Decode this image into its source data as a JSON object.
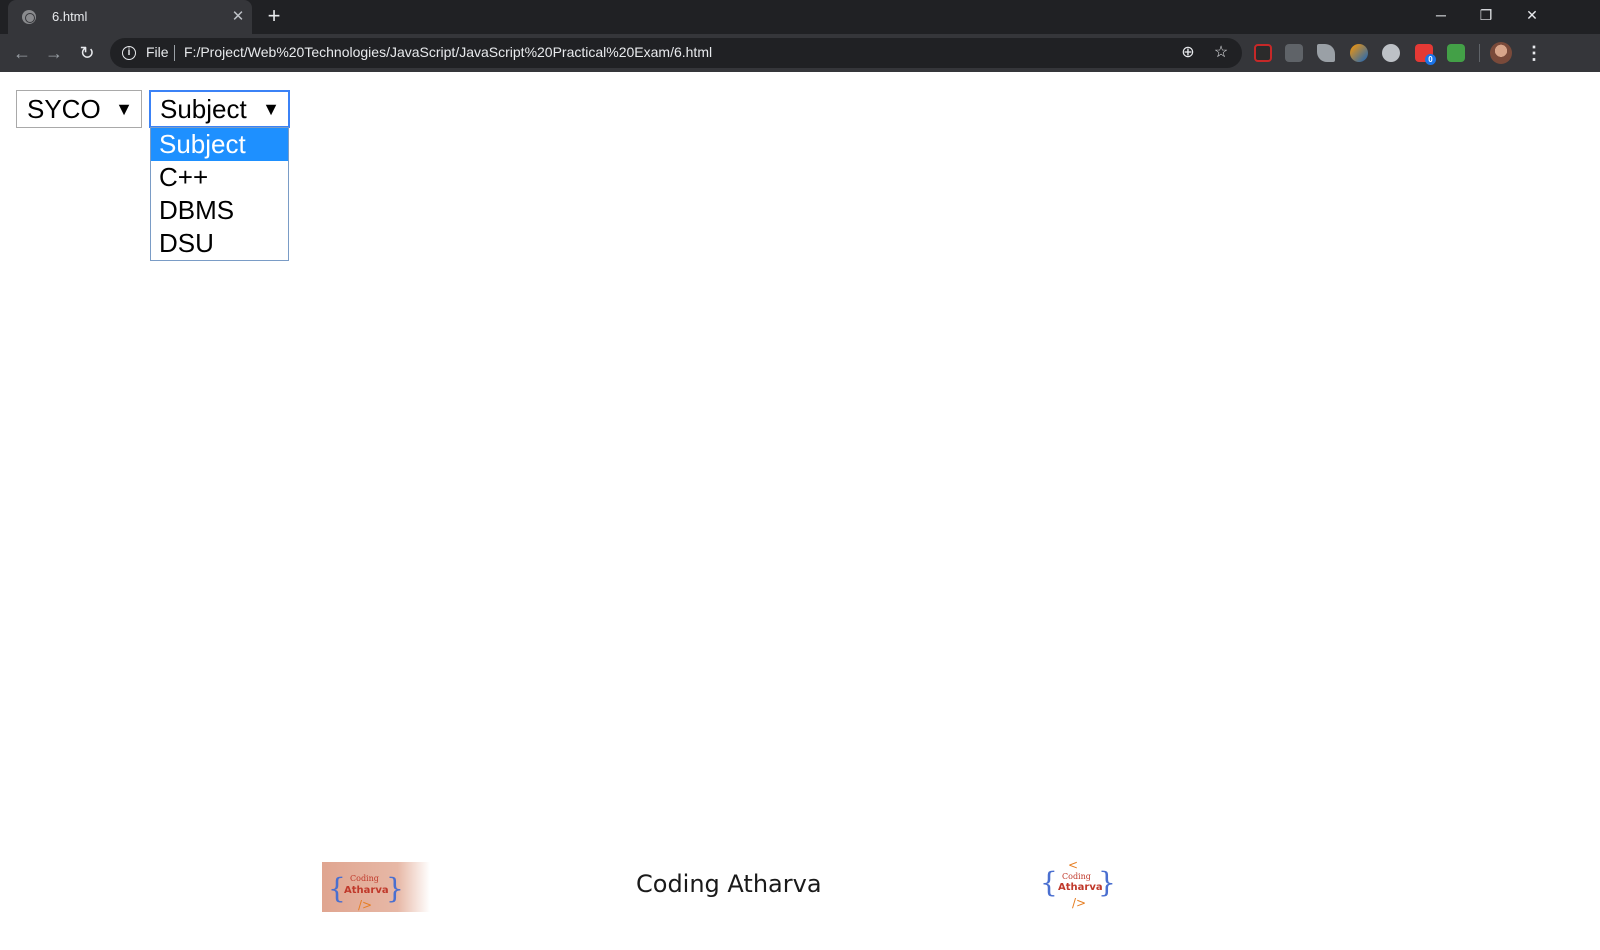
{
  "browser": {
    "tab_title": "6.html",
    "tab_close": "✕",
    "new_tab": "+",
    "window_controls": {
      "minimize": "─",
      "restore": "❐",
      "close": "✕"
    },
    "nav": {
      "back": "←",
      "forward": "→",
      "reload": "↻"
    },
    "omnibox": {
      "info_icon": "i",
      "scheme_label": "File",
      "url": "F:/Project/Web%20Technologies/JavaScript/JavaScript%20Practical%20Exam/6.html",
      "zoom_icon": "⊕",
      "star_icon": "☆"
    },
    "extension_badge": "0",
    "menu_icon": "⋮",
    "colors": {
      "tabstrip": "#202124",
      "toolbar": "#35363a",
      "omnibox": "#202124"
    }
  },
  "page": {
    "class_select": {
      "value": "SYCO",
      "arrow": "▼"
    },
    "subject_select": {
      "value": "Subject",
      "arrow": "▼",
      "expanded": true,
      "options": [
        "Subject",
        "C++",
        "DBMS",
        "DSU"
      ],
      "highlighted_index": 0
    },
    "colors": {
      "highlight": "#1e90ff",
      "focus_ring": "#3b82f6"
    }
  },
  "footer": {
    "title": "Coding Atharva",
    "logo": {
      "small_word": "Coding",
      "bold_word": "Atharva",
      "open_brace": "{",
      "close_brace": "}",
      "tag_top": "<",
      "tag_bottom": "/>"
    }
  }
}
